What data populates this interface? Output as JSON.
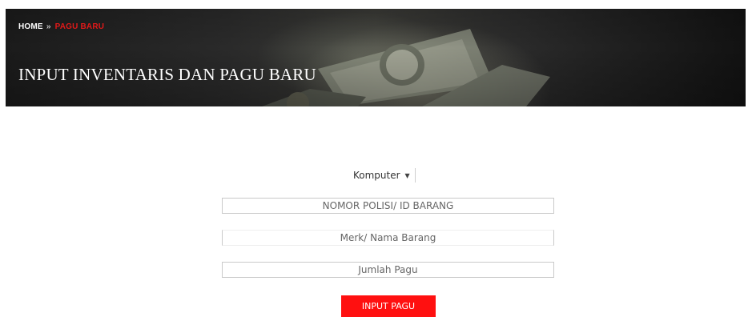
{
  "breadcrumb": {
    "home": "HOME",
    "separator": "»",
    "current": "PAGU BARU"
  },
  "header": {
    "title": "INPUT INVENTARIS DAN PAGU BARU"
  },
  "form": {
    "category_select": {
      "value": "Komputer"
    },
    "fields": [
      {
        "placeholder": "NOMOR POLISI/ ID BARANG"
      },
      {
        "placeholder": "Merk/ Nama Barang"
      },
      {
        "placeholder": "Jumlah Pagu"
      }
    ],
    "submit_label": "INPUT PAGU"
  },
  "colors": {
    "accent": "#ff1010",
    "breadcrumb_current": "#e01919"
  }
}
